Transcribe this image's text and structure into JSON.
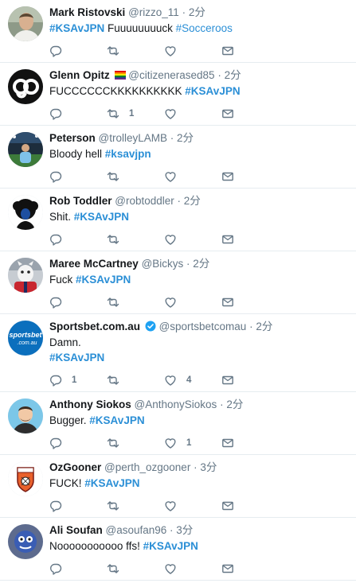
{
  "tweets": [
    {
      "name": "Mark Ristovski",
      "handle": "@rizzo_11",
      "time": "2分",
      "segments": [
        {
          "text": "#KSAvJPN",
          "type": "tag"
        },
        {
          "text": " Fuuuuuuuuck ",
          "type": "plain"
        },
        {
          "text": "#Socceroos",
          "type": "tag-light"
        }
      ],
      "reply_count": "",
      "retweet_count": "",
      "like_count": "",
      "avatar": "man-photo-avatar"
    },
    {
      "name": "Glenn Opitz",
      "handle": "@citizenerased85",
      "time": "2分",
      "has_flag": true,
      "segments": [
        {
          "text": "FUCCCCCCKKKKKKKKKK ",
          "type": "plain"
        },
        {
          "text": "#KSAvJPN",
          "type": "tag"
        }
      ],
      "reply_count": "",
      "retweet_count": "1",
      "like_count": "",
      "avatar": "go-logo-avatar"
    },
    {
      "name": "Peterson",
      "handle": "@trolleyLAMB",
      "time": "2分",
      "segments": [
        {
          "text": "Bloody hell ",
          "type": "plain"
        },
        {
          "text": "#ksavjpn",
          "type": "tag"
        }
      ],
      "reply_count": "",
      "retweet_count": "",
      "like_count": "",
      "avatar": "stadium-photo-avatar"
    },
    {
      "name": "Rob Toddler",
      "handle": "@robtoddler",
      "time": "2分",
      "segments": [
        {
          "text": "Shit. ",
          "type": "plain"
        },
        {
          "text": "#KSAvJPN",
          "type": "tag"
        }
      ],
      "reply_count": "",
      "retweet_count": "",
      "like_count": "",
      "avatar": "afro-silhouette-avatar"
    },
    {
      "name": "Maree McCartney",
      "handle": "@Bickys",
      "time": "2分",
      "segments": [
        {
          "text": "Fuck ",
          "type": "plain"
        },
        {
          "text": "#KSAvJPN",
          "type": "tag"
        }
      ],
      "reply_count": "",
      "retweet_count": "",
      "like_count": "",
      "avatar": "mascot-photo-avatar"
    },
    {
      "name": "Sportsbet.com.au",
      "handle": "@sportsbetcomau",
      "time": "2分",
      "verified": true,
      "lines": [
        [
          {
            "text": "Damn.",
            "type": "plain"
          }
        ],
        [
          {
            "text": "#KSAvJPN",
            "type": "tag"
          }
        ]
      ],
      "reply_count": "1",
      "retweet_count": "",
      "like_count": "4",
      "avatar": "sportsbet-logo-avatar",
      "avatar_text": "sportsbet .com.au"
    },
    {
      "name": "Anthony Siokos",
      "handle": "@AnthonySiokos",
      "time": "2分",
      "segments": [
        {
          "text": "Bugger. ",
          "type": "plain"
        },
        {
          "text": "#KSAvJPN",
          "type": "tag"
        }
      ],
      "reply_count": "",
      "retweet_count": "",
      "like_count": "1",
      "avatar": "cartoon-man-avatar"
    },
    {
      "name": "OzGooner",
      "handle": "@perth_ozgooner",
      "time": "3分",
      "segments": [
        {
          "text": "FUCK! ",
          "type": "plain"
        },
        {
          "text": "#KSAvJPN",
          "type": "tag"
        }
      ],
      "reply_count": "",
      "retweet_count": "",
      "like_count": "",
      "avatar": "crest-avatar"
    },
    {
      "name": "Ali Soufan",
      "handle": "@asoufan96",
      "time": "3分",
      "segments": [
        {
          "text": "Nooooooooooo ffs! ",
          "type": "plain"
        },
        {
          "text": "#KSAvJPN",
          "type": "tag"
        }
      ],
      "reply_count": "",
      "retweet_count": "",
      "like_count": "",
      "avatar": "blue-face-photo-avatar"
    }
  ],
  "separator": " · ",
  "colors": {
    "hashtag": "#2b8fd6",
    "meta": "#657786",
    "divider": "#e6ecf0",
    "text": "#14171a"
  },
  "icons": [
    "reply-icon",
    "retweet-icon",
    "like-icon",
    "message-icon",
    "rainbow-flag-icon",
    "verified-icon"
  ]
}
